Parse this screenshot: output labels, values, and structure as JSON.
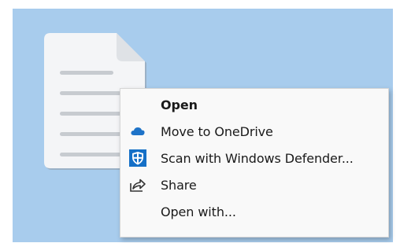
{
  "menu": {
    "items": [
      {
        "label": "Open",
        "icon": null,
        "bold": true
      },
      {
        "label": "Move to OneDrive",
        "icon": "onedrive-cloud-icon"
      },
      {
        "label": "Scan with Windows Defender...",
        "icon": "windows-defender-shield-icon"
      },
      {
        "label": "Share",
        "icon": "share-icon"
      },
      {
        "label": "Open with...",
        "icon": null
      }
    ]
  },
  "colors": {
    "desktop": "#a8cced",
    "menu_background": "#f9f9f9",
    "onedrive_blue": "#1e73c8",
    "defender_blue": "#1570c7"
  }
}
